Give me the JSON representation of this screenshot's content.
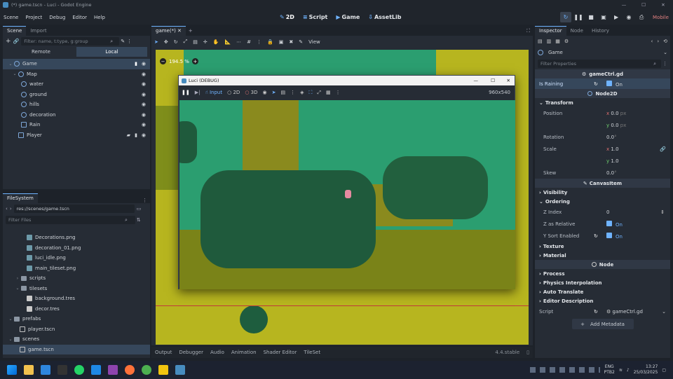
{
  "window": {
    "title": "(*) game.tscn - Luci - Godot Engine",
    "controls": [
      "—",
      "☐",
      "✕"
    ]
  },
  "menu": [
    "Scene",
    "Project",
    "Debug",
    "Editor",
    "Help"
  ],
  "workspaces": [
    {
      "label": "2D",
      "icon": "✎"
    },
    {
      "label": "Script",
      "icon": "≡"
    },
    {
      "label": "Game",
      "icon": "▶"
    },
    {
      "label": "AssetLib",
      "icon": "⇩"
    }
  ],
  "renderer": "Mobile",
  "scene_dock": {
    "tabs": [
      "Scene",
      "Import"
    ],
    "filter_placeholder": "Filter: name, t:type, g:group",
    "remote": "Remote",
    "local": "Local",
    "nodes": [
      {
        "label": "Game",
        "depth": 0
      },
      {
        "label": "Map",
        "depth": 1
      },
      {
        "label": "water",
        "depth": 2
      },
      {
        "label": "ground",
        "depth": 2
      },
      {
        "label": "hills",
        "depth": 2
      },
      {
        "label": "decoration",
        "depth": 2
      },
      {
        "label": "Rain",
        "depth": 2
      },
      {
        "label": "Player",
        "depth": 1
      }
    ]
  },
  "filesystem": {
    "tab": "FileSystem",
    "path": "res://scenes/game.tscn",
    "filter_placeholder": "Filter Files",
    "items": [
      {
        "label": "Decorations.png",
        "depth": 3,
        "kind": "img"
      },
      {
        "label": "decoration_01.png",
        "depth": 3,
        "kind": "img"
      },
      {
        "label": "luci_idle.png",
        "depth": 3,
        "kind": "img"
      },
      {
        "label": "main_tileset.png",
        "depth": 3,
        "kind": "img"
      },
      {
        "label": "scripts",
        "depth": 2,
        "kind": "folder"
      },
      {
        "label": "tilesets",
        "depth": 2,
        "kind": "folder"
      },
      {
        "label": "background.tres",
        "depth": 3,
        "kind": "res"
      },
      {
        "label": "decor.tres",
        "depth": 3,
        "kind": "res"
      },
      {
        "label": "prefabs",
        "depth": 1,
        "kind": "folder"
      },
      {
        "label": "player.tscn",
        "depth": 2,
        "kind": "scene"
      },
      {
        "label": "scenes",
        "depth": 1,
        "kind": "folder"
      },
      {
        "label": "game.tscn",
        "depth": 2,
        "kind": "scene"
      }
    ]
  },
  "viewport": {
    "tab": "game(*)",
    "zoom": "194.5 %",
    "view_label": "View"
  },
  "debug_window": {
    "title": "Luci (DEBUG)",
    "input_label": "Input",
    "mode_2d": "2D",
    "mode_3d": "3D",
    "resolution": "960x540"
  },
  "bottom_tabs": [
    "Output",
    "Debugger",
    "Audio",
    "Animation",
    "Shader Editor",
    "TileSet"
  ],
  "version": "4.4.stable",
  "inspector": {
    "tabs": [
      "Inspector",
      "Node",
      "History"
    ],
    "node_name": "Game",
    "filter_placeholder": "Filter Properties",
    "script_name": "gameCtrl.gd",
    "is_raining_label": "Is Raining",
    "on": "On",
    "class_node2d": "Node2D",
    "transform": "Transform",
    "position": "Position",
    "pos_x": "0.0",
    "pos_y": "0.0",
    "px": "px",
    "rotation": "Rotation",
    "rotation_val": "0.0",
    "deg": "°",
    "scale": "Scale",
    "scale_x": "1.0",
    "scale_y": "1.0",
    "skew": "Skew",
    "skew_val": "0.0",
    "class_canvasitem": "CanvasItem",
    "visibility": "Visibility",
    "ordering": "Ordering",
    "z_index": "Z Index",
    "z_val": "0",
    "z_relative": "Z as Relative",
    "y_sort": "Y Sort Enabled",
    "texture": "Texture",
    "material": "Material",
    "class_node": "Node",
    "process": "Process",
    "physics": "Physics Interpolation",
    "auto_translate": "Auto Translate",
    "editor_desc": "Editor Description",
    "script_label": "Script",
    "add_metadata": "Add Metadata"
  },
  "taskbar": {
    "lang": "ENG",
    "layout": "PTB2",
    "time": "13:27",
    "date": "25/03/2025"
  }
}
